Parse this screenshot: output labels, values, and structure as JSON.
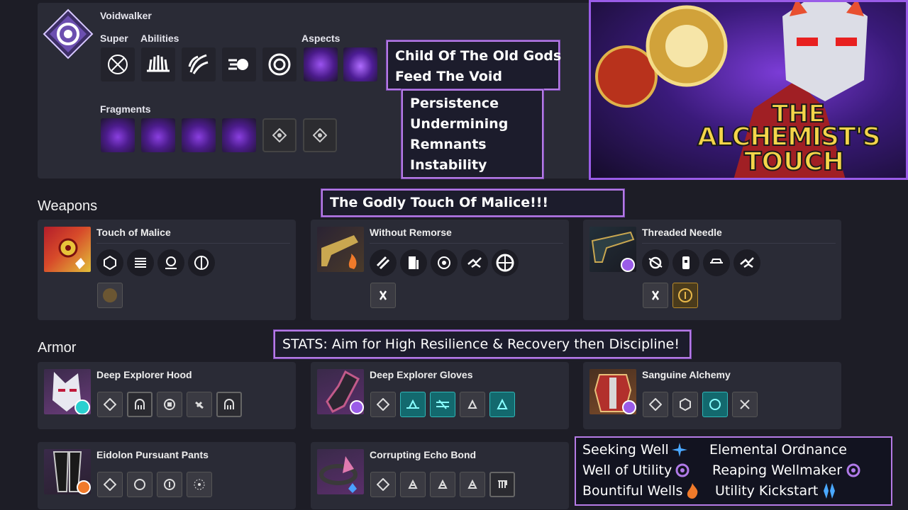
{
  "subclass": {
    "name": "Voidwalker",
    "super_label": "Super",
    "abilities_label": "Abilities",
    "aspects_label": "Aspects",
    "fragments_label": "Fragments"
  },
  "annotations": {
    "aspects_note": [
      "Child Of The Old Gods",
      "Feed The Void"
    ],
    "fragments_note": [
      "Persistence",
      "Undermining",
      "Remnants",
      "Instability"
    ],
    "weapons_note": "The Godly Touch Of Malice!!!",
    "stats_note": "STATS: Aim for High Resilience & Recovery then Discipline!"
  },
  "thumbnail": {
    "title_line1": "THE",
    "title_line2": "ALCHEMIST'S",
    "title_line3": "TOUCH"
  },
  "sections": {
    "weapons": "Weapons",
    "armor": "Armor"
  },
  "weapons": [
    {
      "name": "Touch of Malice"
    },
    {
      "name": "Without Remorse"
    },
    {
      "name": "Threaded Needle"
    }
  ],
  "armor": [
    {
      "name": "Deep Explorer Hood"
    },
    {
      "name": "Deep Explorer Gloves"
    },
    {
      "name": "Sanguine Alchemy"
    },
    {
      "name": "Eidolon Pursuant Pants"
    },
    {
      "name": "Corrupting Echo Bond"
    }
  ],
  "legend": {
    "col1": [
      "Seeking Well",
      "Well of Utility",
      "Bountiful Wells"
    ],
    "col2": [
      "Elemental Ordnance",
      "Reaping Wellmaker",
      "Utility Kickstart"
    ]
  },
  "colors": {
    "void": "#9a5ce8",
    "annotation_border": "#b67be6",
    "panel": "#2a2b36",
    "background": "#1d1d26",
    "teal_mod": "#13696e",
    "solar": "#f07a2a",
    "arc": "#5ab8ff"
  }
}
